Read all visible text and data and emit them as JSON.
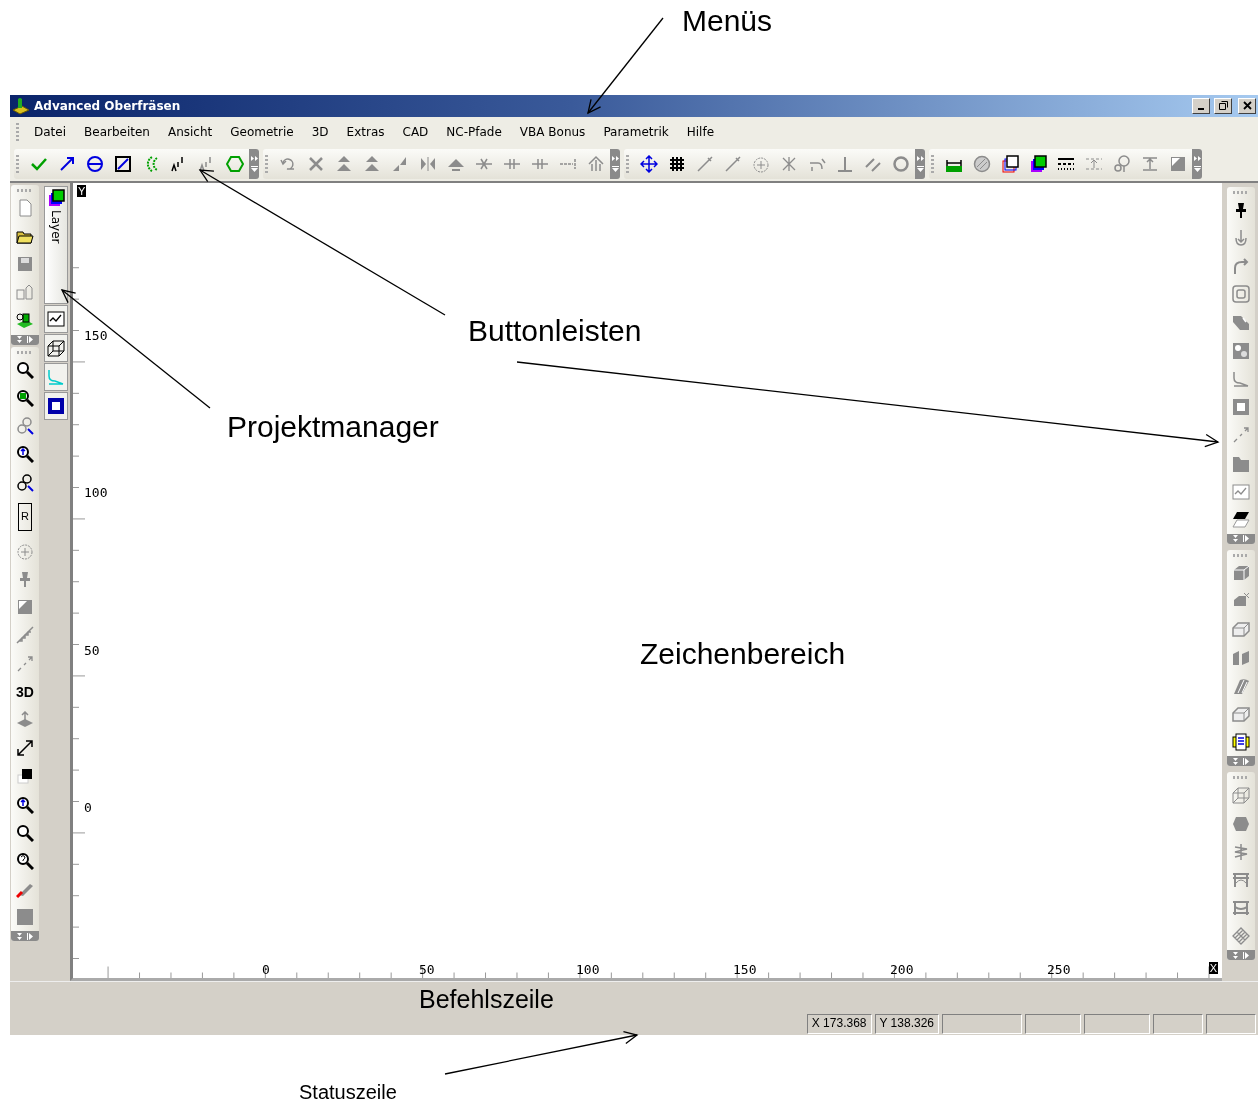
{
  "window": {
    "title": "Advanced Oberfräsen"
  },
  "menus": [
    {
      "label": "Datei"
    },
    {
      "label": "Bearbeiten"
    },
    {
      "label": "Ansicht"
    },
    {
      "label": "Geometrie"
    },
    {
      "label": "3D"
    },
    {
      "label": "Extras"
    },
    {
      "label": "CAD"
    },
    {
      "label": "NC-Pfade"
    },
    {
      "label": "VBA Bonus"
    },
    {
      "label": "Parametrik"
    },
    {
      "label": "Hilfe"
    }
  ],
  "left_toolbar": {
    "text_buttons": [
      "R",
      "3D"
    ]
  },
  "project_manager": {
    "tabs": [
      {
        "label": "Layer",
        "selected": true
      }
    ]
  },
  "drawing_area": {
    "y_marker": "Y",
    "x_marker": "X",
    "y_labels": [
      "150",
      "100",
      "50",
      "0"
    ],
    "x_labels": [
      "0",
      "50",
      "100",
      "150",
      "200",
      "250"
    ]
  },
  "status_bar": {
    "panels": [
      "X 173.368",
      "Y 138.326"
    ]
  },
  "annotations": [
    {
      "text": "Menüs"
    },
    {
      "text": "Buttonleisten"
    },
    {
      "text": "Projektmanager"
    },
    {
      "text": "Zeichenbereich"
    },
    {
      "text": "Befehlszeile"
    },
    {
      "text": "Statuszeile"
    }
  ]
}
